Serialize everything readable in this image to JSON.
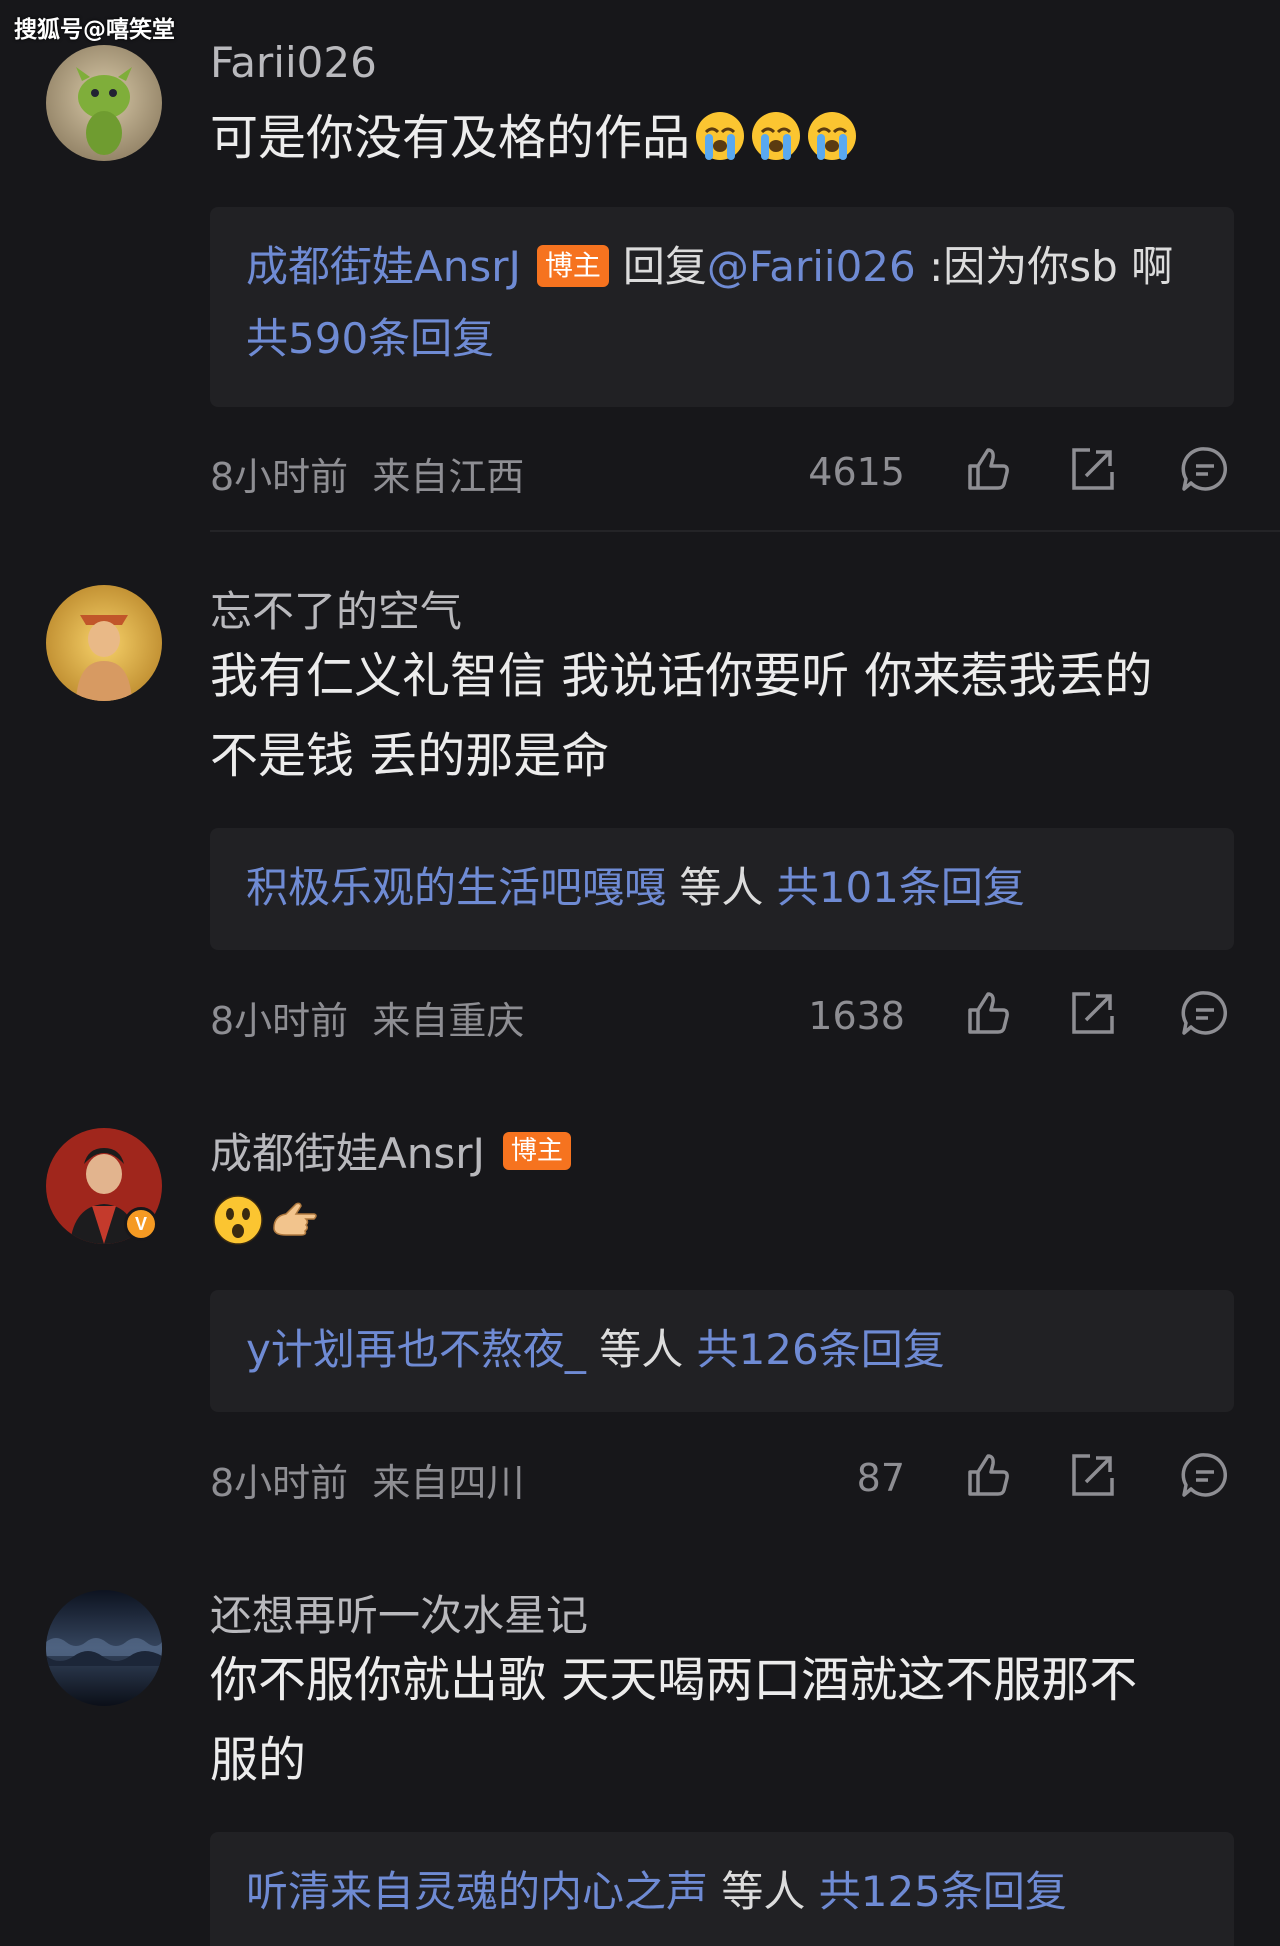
{
  "watermark": "搜狐号@嘻笑堂",
  "comments": [
    {
      "username": "Farii026",
      "content": "可是你没有及格的作品",
      "content_emoji": "crying-face x3",
      "reply": {
        "author": "成都街娃AnsrJ",
        "author_badge": "博主",
        "reply_word": "回复",
        "reply_to": "@Farii026",
        "reply_text": " :因为你sb 啊",
        "total": "共590条回复"
      },
      "time": "8小时前",
      "location": "来自江西",
      "likes": "4615"
    },
    {
      "username": "忘不了的空气",
      "content_line1": "我有仁义礼智信 我说话你要听 你来惹我丢的",
      "content_line2": "不是钱 丢的那是命",
      "reply": {
        "author": "积极乐观的生活吧嘎嘎",
        "others": " 等人 ",
        "total": "共101条回复"
      },
      "time": "8小时前",
      "location": "来自重庆",
      "likes": "1638"
    },
    {
      "username": "成都街娃AnsrJ",
      "user_badge": "博主",
      "verified": "V",
      "content_emoji": "surprised-face, pointing-hand",
      "reply": {
        "author": "y计划再也不熬夜_",
        "others": " 等人 ",
        "total": "共126条回复"
      },
      "time": "8小时前",
      "location": "来自四川",
      "likes": "87"
    },
    {
      "username": "还想再听一次水星记",
      "content_line1": "你不服你就出歌 天天喝两口酒就这不服那不",
      "content_line2": "服的",
      "reply": {
        "author": "听清来自灵魂的内心之声",
        "others": " 等人 ",
        "total": "共125条回复"
      }
    }
  ],
  "icons": {
    "like": "thumbs-up-icon",
    "share": "share-icon",
    "comment": "comment-icon"
  },
  "colors": {
    "background": "#17171a",
    "link_blue": "#6f8bd4",
    "badge_orange": "#f6731f"
  }
}
